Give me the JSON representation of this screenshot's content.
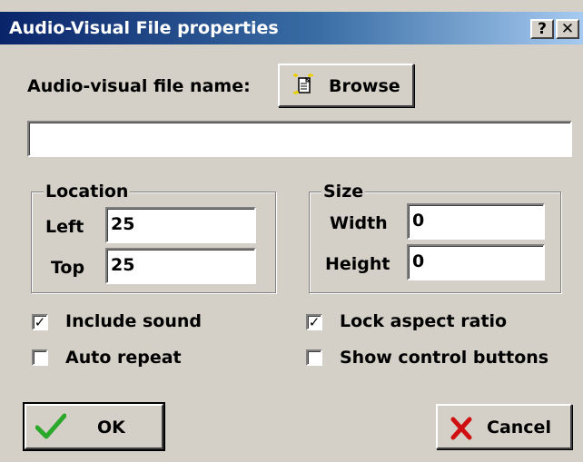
{
  "window": {
    "title": "Audio-Visual File properties",
    "help_label": "?",
    "close_label": "✕"
  },
  "file": {
    "name_label": "Audio-visual file name:",
    "browse_label": "Browse",
    "path_value": ""
  },
  "location": {
    "legend": "Location",
    "left_label": "Left",
    "left_value": "25",
    "top_label": "Top",
    "top_value": "25"
  },
  "size": {
    "legend": "Size",
    "width_label": "Width",
    "width_value": "0",
    "height_label": "Height",
    "height_value": "0"
  },
  "options": {
    "include_sound": {
      "label": "Include sound",
      "checked": true
    },
    "auto_repeat": {
      "label": "Auto repeat",
      "checked": false
    },
    "lock_aspect": {
      "label": "Lock aspect ratio",
      "checked": true
    },
    "show_controls": {
      "label": "Show control buttons",
      "checked": false
    }
  },
  "actions": {
    "ok_label": "OK",
    "cancel_label": "Cancel"
  },
  "colors": {
    "titlebar_start": "#0a246a",
    "titlebar_end": "#a6caf0",
    "face": "#d4d0c8",
    "ok_check": "#2aa82a",
    "cancel_x": "#d01010"
  },
  "icons": {
    "browse": "document-sparkle-icon",
    "ok": "checkmark-icon",
    "cancel": "red-x-icon"
  }
}
